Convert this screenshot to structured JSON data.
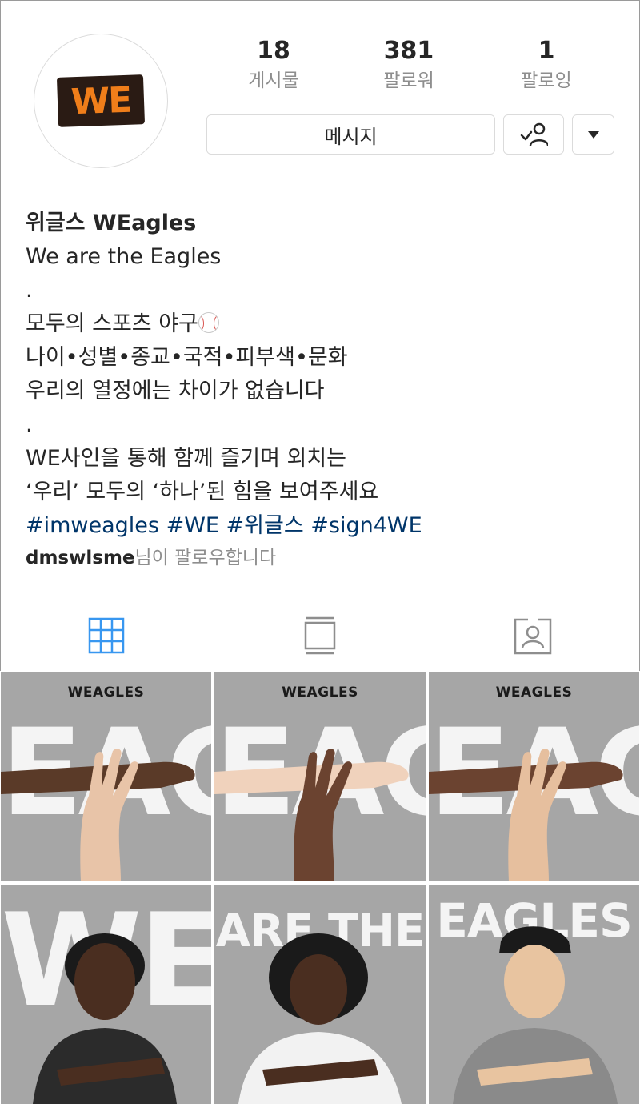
{
  "profile": {
    "logo_text": "WE",
    "stats": [
      {
        "value": "18",
        "label": "게시물"
      },
      {
        "value": "381",
        "label": "팔로워"
      },
      {
        "value": "1",
        "label": "팔로잉"
      }
    ],
    "message_button": "메시지",
    "following_icon": "person-check-icon",
    "more_icon": "caret-down-icon"
  },
  "bio": {
    "name": "위글스 WEagles",
    "lines": [
      "We are the Eagles",
      ".",
      "모두의 스포츠 야구",
      "나이•성별•종교•국적•피부색•문화",
      "우리의 열정에는 차이가 없습니다",
      ".",
      "WE사인을 통해 함께 즐기며 외치는",
      "‘우리’ 모두의 ‘하나’된 힘을 보여주세요"
    ],
    "hashtags": "#imweagles #WE #위글스 #sign4WE",
    "followed_by_user": "dmswlsme",
    "followed_by_suffix": "님이 팔로우합니다"
  },
  "tabs": [
    {
      "icon": "grid-icon",
      "active": true
    },
    {
      "icon": "feed-icon",
      "active": false
    },
    {
      "icon": "tagged-icon",
      "active": false
    }
  ],
  "posts": [
    {
      "brand": "WEAGLES",
      "text": "EAGLES"
    },
    {
      "brand": "WEAGLES",
      "text": "EAGLES"
    },
    {
      "brand": "WEAGLES",
      "text": "EAGLES"
    },
    {
      "brand": "",
      "text": "WE"
    },
    {
      "brand": "",
      "text": "ARE THE"
    },
    {
      "brand": "",
      "text": "EAGLES"
    }
  ],
  "colors": {
    "accent": "#3897f0",
    "hashtag": "#003569",
    "muted": "#8e8e8e",
    "logo_orange": "#f07e1a"
  }
}
